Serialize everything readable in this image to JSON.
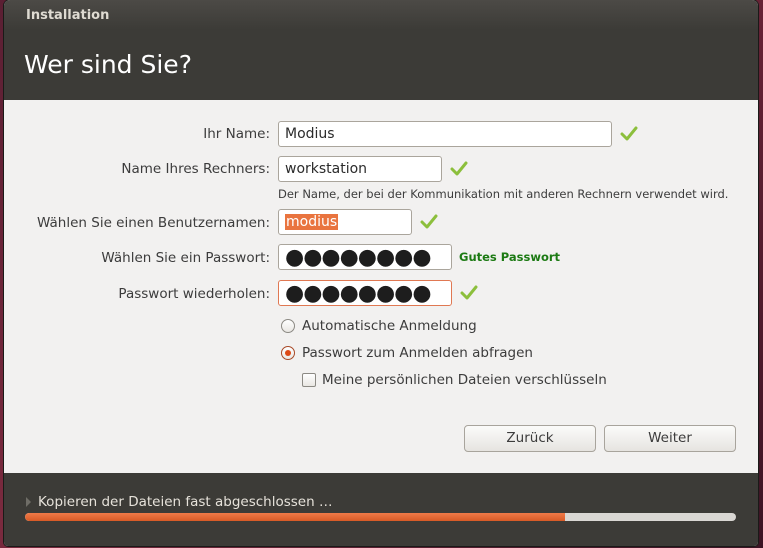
{
  "window": {
    "title": "Installation",
    "page_title": "Wer sind Sie?"
  },
  "form": {
    "name": {
      "label": "Ihr Name:",
      "value": "Modius"
    },
    "computer_name": {
      "label": "Name Ihres Rechners:",
      "value": "workstation",
      "hint": "Der Name, der bei der Kommunikation mit anderen Rechnern verwendet wird."
    },
    "username": {
      "label": "Wählen Sie einen Benutzernamen:",
      "value": "modius"
    },
    "password": {
      "label": "Wählen Sie ein Passwort:",
      "value": "●●●●●●●●",
      "strength": "Gutes Passwort"
    },
    "password_repeat": {
      "label": "Passwort wiederholen:",
      "value": "●●●●●●●●"
    }
  },
  "options": {
    "auto_login": {
      "label": "Automatische Anmeldung",
      "selected": false
    },
    "ask_password": {
      "label": "Passwort zum Anmelden abfragen",
      "selected": true
    },
    "encrypt_home": {
      "label": "Meine persönlichen Dateien verschlüsseln",
      "checked": false
    }
  },
  "buttons": {
    "back": "Zurück",
    "next": "Weiter"
  },
  "footer": {
    "status": "Kopieren der Dateien fast abgeschlossen …",
    "progress_percent": 76
  },
  "colors": {
    "accent": "#dd4814",
    "check_green": "#8cbf3c",
    "strength_green": "#1c7a13"
  }
}
